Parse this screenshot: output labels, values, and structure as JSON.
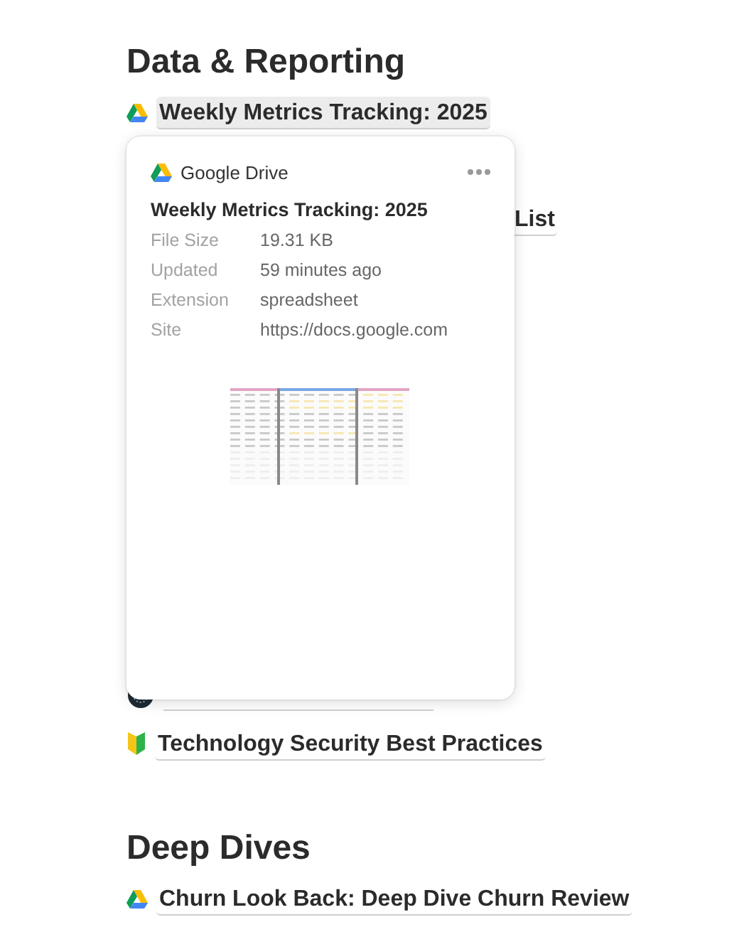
{
  "sections": [
    {
      "heading": "Data & Reporting",
      "items": [
        {
          "kind": "drive",
          "title": "Weekly Metrics Tracking: 2025",
          "highlighted": true
        },
        {
          "kind": "partial",
          "title": "List",
          "highlighted": false
        },
        {
          "kind": "timer"
        },
        {
          "kind": "shield",
          "title": "Technology Security Best Practices",
          "highlighted": false
        }
      ]
    },
    {
      "heading": "Deep Dives",
      "items": [
        {
          "kind": "drive",
          "title": "Churn Look Back: Deep Dive Churn Review",
          "highlighted": false
        }
      ]
    }
  ],
  "preview": {
    "source": "Google Drive",
    "title": "Weekly Metrics Tracking: 2025",
    "fields": [
      {
        "label": "File Size",
        "value": "19.31 KB"
      },
      {
        "label": "Updated",
        "value": "59 minutes ago"
      },
      {
        "label": "Extension",
        "value": "spreadsheet"
      },
      {
        "label": "Site",
        "value": "https://docs.google.com"
      }
    ]
  }
}
